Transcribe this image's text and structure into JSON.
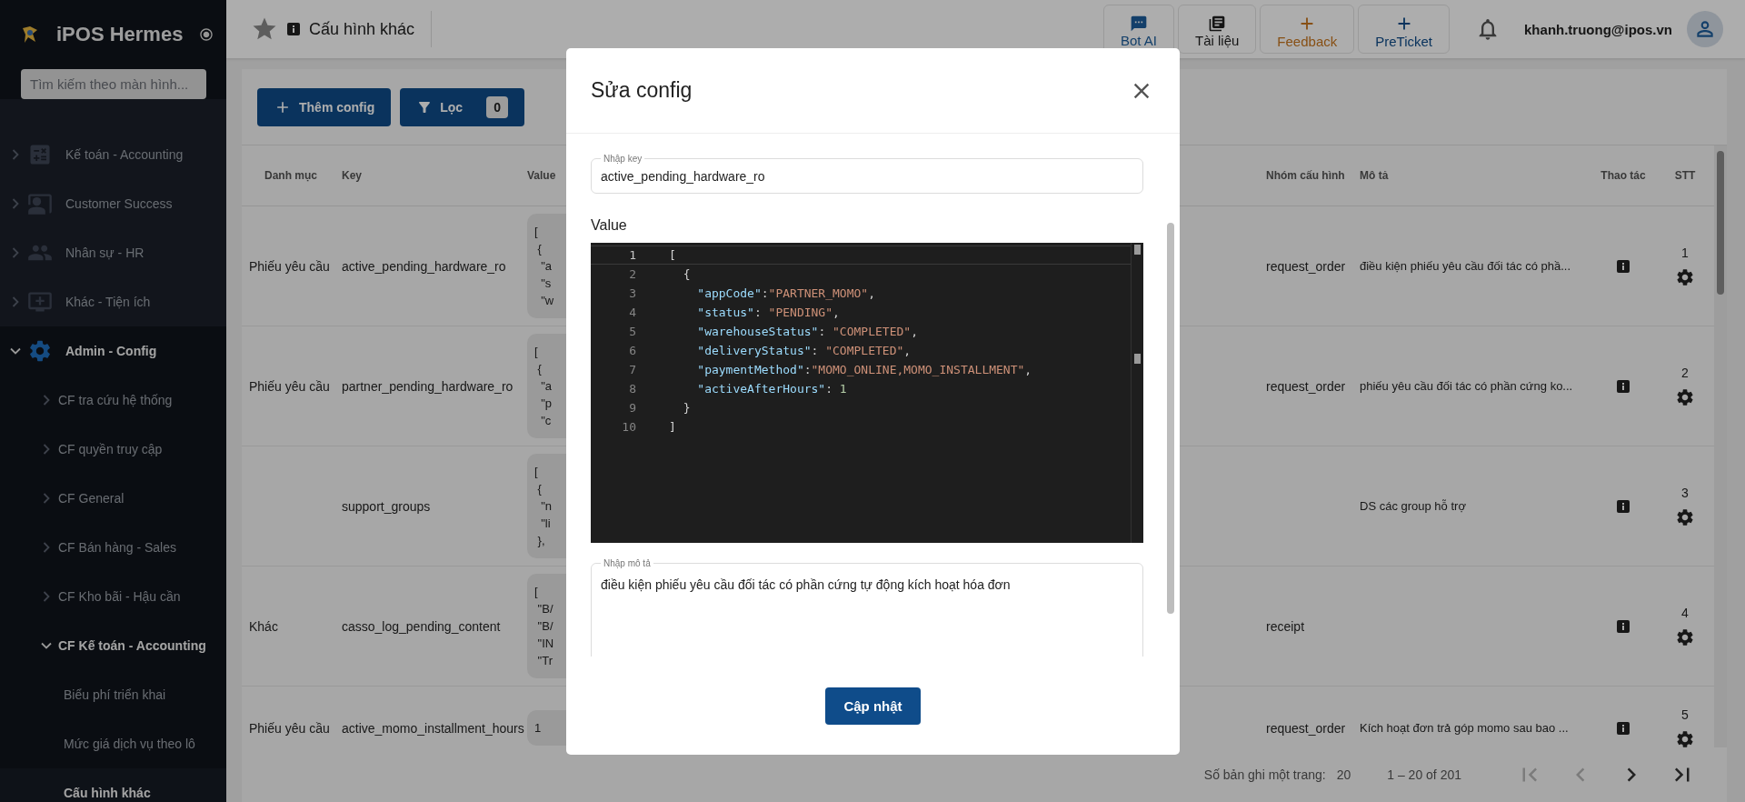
{
  "sidebar": {
    "brand": "iPOS Hermes",
    "search": {
      "placeholder": "Tìm kiếm theo màn hình..."
    },
    "items": [
      {
        "label": "Kế toán - Accounting",
        "expanded": false
      },
      {
        "label": "Customer Success",
        "expanded": false
      },
      {
        "label": "Nhân sự - HR",
        "expanded": false
      },
      {
        "label": "Khác - Tiện ích",
        "expanded": false
      },
      {
        "label": "Admin - Config",
        "expanded": true,
        "children": [
          {
            "label": "CF tra cứu hệ thống",
            "expanded": false
          },
          {
            "label": "CF quyền truy cập",
            "expanded": false
          },
          {
            "label": "CF General",
            "expanded": false
          },
          {
            "label": "CF Bán hàng - Sales",
            "expanded": false
          },
          {
            "label": "CF Kho bãi - Hậu cần",
            "expanded": false
          },
          {
            "label": "CF Kế toán - Accounting",
            "expanded": true,
            "children": [
              {
                "label": "Biểu phí triển khai",
                "selected": false
              },
              {
                "label": "Mức giá dịch vụ theo lô",
                "selected": false
              },
              {
                "label": "Cấu hình khác",
                "selected": true
              }
            ]
          }
        ]
      }
    ]
  },
  "header": {
    "title": "Cấu hình khác",
    "actions": [
      {
        "label": "Bot AI",
        "kind": "chat"
      },
      {
        "label": "Tài liệu",
        "kind": "book"
      },
      {
        "label": "Feedback",
        "kind": "plus_accent"
      },
      {
        "label": "PreTicket",
        "kind": "plus_primary"
      }
    ],
    "user": "khanh.truong@ipos.vn"
  },
  "toolbar": {
    "add_button": "Thêm config",
    "filter_button": "Lọc",
    "filter_count": "0"
  },
  "table": {
    "columns": [
      "Danh mục",
      "Key",
      "Value",
      "Nhóm cấu hình",
      "Mô tả",
      "Thao tác",
      "STT"
    ],
    "rows": [
      {
        "category": "Phiếu yêu cầu",
        "key": "active_pending_hardware_ro",
        "value": [
          "[",
          " {",
          "  \"a",
          "  \"s",
          "  \"w"
        ],
        "group": "request_order",
        "description": "điều kiện phiếu yêu cầu đối tác có phầ...",
        "index": "1"
      },
      {
        "category": "Phiếu yêu cầu",
        "key": "partner_pending_hardware_ro",
        "value": [
          "[",
          " {",
          "  \"a",
          "  \"p",
          "  \"c"
        ],
        "group": "request_order",
        "description": "phiếu yêu cầu đối tác có phần cứng ko...",
        "index": "2"
      },
      {
        "key": "support_groups",
        "value": [
          "[",
          " {",
          "  \"n",
          "  \"li",
          " },"
        ],
        "description": "DS các group hỗ trợ",
        "index": "3"
      },
      {
        "category": "Khác",
        "key": "casso_log_pending_content",
        "value": [
          "[",
          " \"B/",
          " \"B/",
          " \"IN",
          " \"Tr"
        ],
        "group": "receipt",
        "index": "4"
      },
      {
        "category": "Phiếu yêu cầu",
        "key": "active_momo_installment_hours",
        "value": [
          "1"
        ],
        "group": "request_order",
        "description": "Kích hoạt đơn trả góp momo sau bao ...",
        "index": "5"
      }
    ]
  },
  "pagination": {
    "per_page_label": "Số bản ghi một trang:",
    "per_page": "20",
    "range": "1 – 20 of 201",
    "controls": [
      {
        "kind": "first",
        "disabled": true
      },
      {
        "kind": "prev",
        "disabled": true
      },
      {
        "kind": "next",
        "disabled": false
      },
      {
        "kind": "last",
        "disabled": false
      }
    ]
  },
  "modal": {
    "title": "Sửa config",
    "key_field": {
      "label": "Nhập key",
      "value": "active_pending_hardware_ro"
    },
    "value_label": "Value",
    "editor": {
      "lines": [
        {
          "number": "1",
          "current": true,
          "tokens": [
            {
              "kind": "punct",
              "text": "["
            }
          ]
        },
        {
          "number": "2",
          "current": false,
          "tokens": [
            {
              "kind": "punct",
              "text": "  {"
            }
          ]
        },
        {
          "number": "3",
          "current": false,
          "tokens": [
            {
              "kind": "key",
              "text": "    \"appCode\""
            },
            {
              "kind": "punct",
              "text": ":"
            },
            {
              "kind": "string",
              "text": "\"PARTNER_MOMO\""
            },
            {
              "kind": "punct",
              "text": ","
            }
          ]
        },
        {
          "number": "4",
          "current": false,
          "tokens": [
            {
              "kind": "key",
              "text": "    \"status\""
            },
            {
              "kind": "punct",
              "text": ": "
            },
            {
              "kind": "string",
              "text": "\"PENDING\""
            },
            {
              "kind": "punct",
              "text": ","
            }
          ]
        },
        {
          "number": "5",
          "current": false,
          "tokens": [
            {
              "kind": "key",
              "text": "    \"warehouseStatus\""
            },
            {
              "kind": "punct",
              "text": ": "
            },
            {
              "kind": "string",
              "text": "\"COMPLETED\""
            },
            {
              "kind": "punct",
              "text": ","
            }
          ]
        },
        {
          "number": "6",
          "current": false,
          "tokens": [
            {
              "kind": "key",
              "text": "    \"deliveryStatus\""
            },
            {
              "kind": "punct",
              "text": ": "
            },
            {
              "kind": "string",
              "text": "\"COMPLETED\""
            },
            {
              "kind": "punct",
              "text": ","
            }
          ]
        },
        {
          "number": "7",
          "current": false,
          "tokens": [
            {
              "kind": "key",
              "text": "    \"paymentMethod\""
            },
            {
              "kind": "punct",
              "text": ":"
            },
            {
              "kind": "string",
              "text": "\"MOMO_ONLINE,MOMO_INSTALLMENT\""
            },
            {
              "kind": "punct",
              "text": ","
            }
          ]
        },
        {
          "number": "8",
          "current": false,
          "tokens": [
            {
              "kind": "key",
              "text": "    \"activeAfterHours\""
            },
            {
              "kind": "punct",
              "text": ": "
            },
            {
              "kind": "number",
              "text": "1"
            }
          ]
        },
        {
          "number": "9",
          "current": false,
          "tokens": [
            {
              "kind": "punct",
              "text": "  }"
            }
          ]
        },
        {
          "number": "10",
          "current": false,
          "tokens": [
            {
              "kind": "punct",
              "text": "]"
            }
          ]
        }
      ]
    },
    "description_field": {
      "label": "Nhập mô tả",
      "value": "điều kiện phiếu yêu cầu đối tác có phần cứng tự động kích hoạt hóa đơn"
    },
    "submit_button": "Cập nhật"
  }
}
